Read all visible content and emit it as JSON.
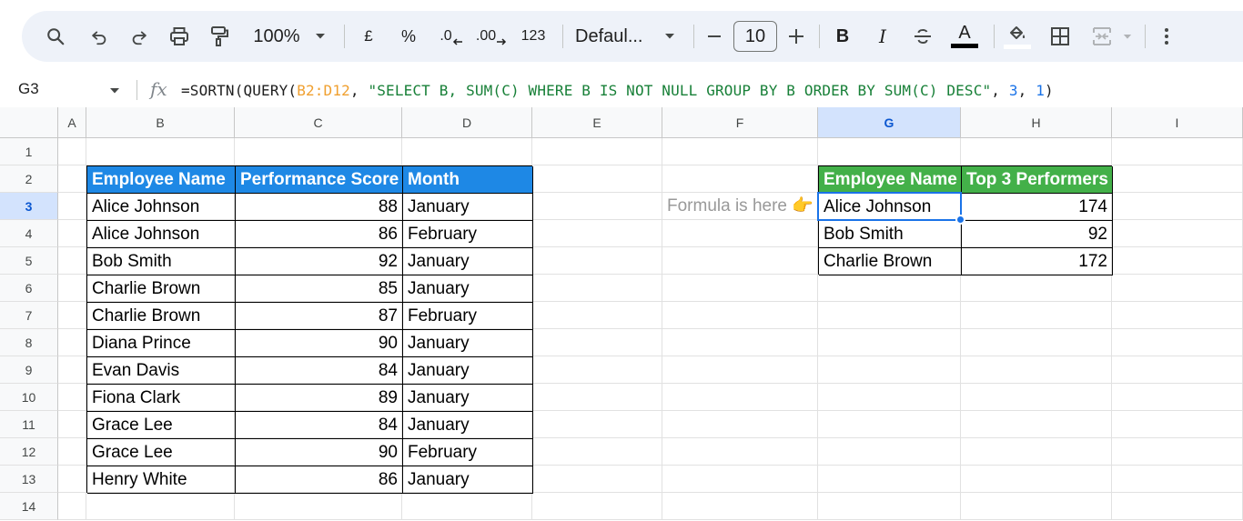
{
  "toolbar": {
    "zoom": "100%",
    "currency": "£",
    "percent": "%",
    "decrease_decimal": ".0",
    "increase_decimal": ".00",
    "more_formats": "123",
    "font": "Defaul...",
    "font_size": "10",
    "bold": "B",
    "italic": "I",
    "text_color": "A"
  },
  "formula_bar": {
    "name_box": "G3",
    "fx": "fx",
    "formula": {
      "p1": "=SORTN(QUERY(",
      "range": "B2:D12",
      "p2": ", ",
      "query": "\"SELECT B, SUM(C) WHERE B IS NOT NULL GROUP BY B ORDER BY SUM(C) DESC\"",
      "p3": ", ",
      "n": "3",
      "p4": ", ",
      "mode": "1",
      "p5": ")"
    }
  },
  "columns": [
    "A",
    "B",
    "C",
    "D",
    "E",
    "F",
    "G",
    "H",
    "I"
  ],
  "selected_column": "G",
  "rows": [
    "1",
    "2",
    "3",
    "4",
    "5",
    "6",
    "7",
    "8",
    "9",
    "10",
    "11",
    "12",
    "13",
    "14"
  ],
  "selected_row": "3",
  "source_table": {
    "headers": [
      "Employee  Name",
      "Performance Score",
      "Month"
    ],
    "rows": [
      [
        "Alice Johnson",
        "88",
        "January"
      ],
      [
        "Alice Johnson",
        "86",
        "February"
      ],
      [
        "Bob Smith",
        "92",
        "January"
      ],
      [
        "Charlie Brown",
        "85",
        "January"
      ],
      [
        "Charlie Brown",
        "87",
        "February"
      ],
      [
        "Diana Prince",
        "90",
        "January"
      ],
      [
        "Evan Davis",
        "84",
        "January"
      ],
      [
        "Fiona Clark",
        "89",
        "January"
      ],
      [
        "Grace Lee",
        "84",
        "January"
      ],
      [
        "Grace Lee",
        "90",
        "February"
      ],
      [
        "Henry White",
        "86",
        "January"
      ]
    ]
  },
  "hint": "Formula is here 👉",
  "result_table": {
    "headers": [
      "Employee Name",
      "Top 3 Performers"
    ],
    "rows": [
      [
        "Alice Johnson",
        "174"
      ],
      [
        "Bob Smith",
        "92"
      ],
      [
        "Charlie Brown",
        "172"
      ]
    ]
  },
  "colors": {
    "source_header": "#1e88e5",
    "result_header": "#43b049",
    "selection": "#1a73e8"
  }
}
